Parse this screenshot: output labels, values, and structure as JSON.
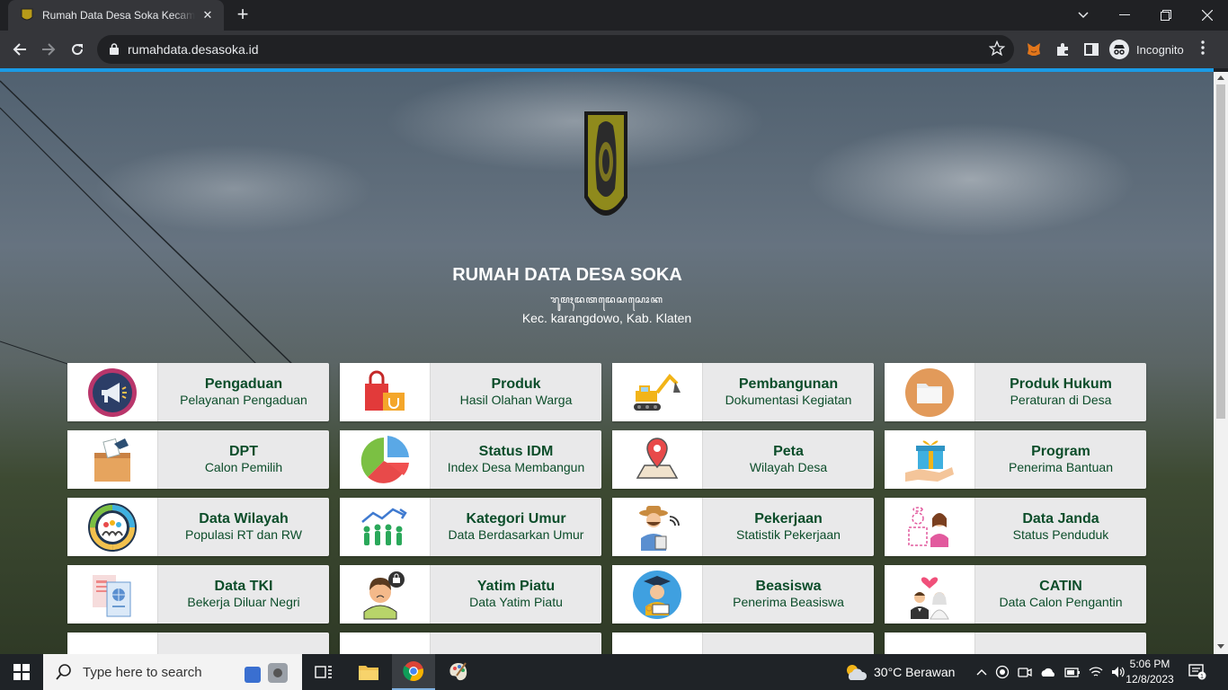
{
  "browser": {
    "tab_title": "Rumah Data Desa Soka Kecamatan Karangdowo",
    "url": "rumahdata.desasoka.id",
    "profile_label": "Incognito"
  },
  "site": {
    "title": "RUMAH DATA DESA SOKA",
    "script_line": "ꦫꦸꦩꦃꦢꦠꦢꦺꦱꦱꦺꦴꦏ",
    "subtitle": "Kec. karangdowo, Kab. Klaten"
  },
  "menu": [
    {
      "title": "Pengaduan",
      "subtitle": "Pelayanan Pengaduan",
      "icon": "megaphone-icon"
    },
    {
      "title": "Produk",
      "subtitle": "Hasil Olahan Warga",
      "icon": "shopping-bag-icon"
    },
    {
      "title": "Pembangunan",
      "subtitle": "Dokumentasi Kegiatan",
      "icon": "excavator-icon"
    },
    {
      "title": "Produk Hukum",
      "subtitle": "Peraturan di Desa",
      "icon": "folder-icon"
    },
    {
      "title": "DPT",
      "subtitle": "Calon Pemilih",
      "icon": "ballot-box-icon"
    },
    {
      "title": "Status IDM",
      "subtitle": "Index Desa Membangun",
      "icon": "pie-chart-icon"
    },
    {
      "title": "Peta",
      "subtitle": "Wilayah Desa",
      "icon": "map-pin-icon"
    },
    {
      "title": "Program",
      "subtitle": "Penerima Bantuan",
      "icon": "gift-hand-icon"
    },
    {
      "title": "Data Wilayah",
      "subtitle": "Populasi RT dan RW",
      "icon": "population-circle-icon"
    },
    {
      "title": "Kategori Umur",
      "subtitle": "Data Berdasarkan Umur",
      "icon": "people-growth-icon"
    },
    {
      "title": "Pekerjaan",
      "subtitle": "Statistik Pekerjaan",
      "icon": "farmer-icon"
    },
    {
      "title": "Data Janda",
      "subtitle": "Status Penduduk",
      "icon": "widow-icon"
    },
    {
      "title": "Data TKI",
      "subtitle": "Bekerja Diluar Negri",
      "icon": "passport-icon"
    },
    {
      "title": "Yatim Piatu",
      "subtitle": "Data Yatim Piatu",
      "icon": "orphan-icon"
    },
    {
      "title": "Beasiswa",
      "subtitle": "Penerima Beasiswa",
      "icon": "graduate-icon"
    },
    {
      "title": "CATIN",
      "subtitle": "Data Calon Pengantin",
      "icon": "wedding-couple-icon"
    }
  ],
  "taskbar": {
    "search_placeholder": "Type here to search",
    "weather": "30°C  Berawan",
    "time": "5:06 PM",
    "date": "12/8/2023"
  }
}
